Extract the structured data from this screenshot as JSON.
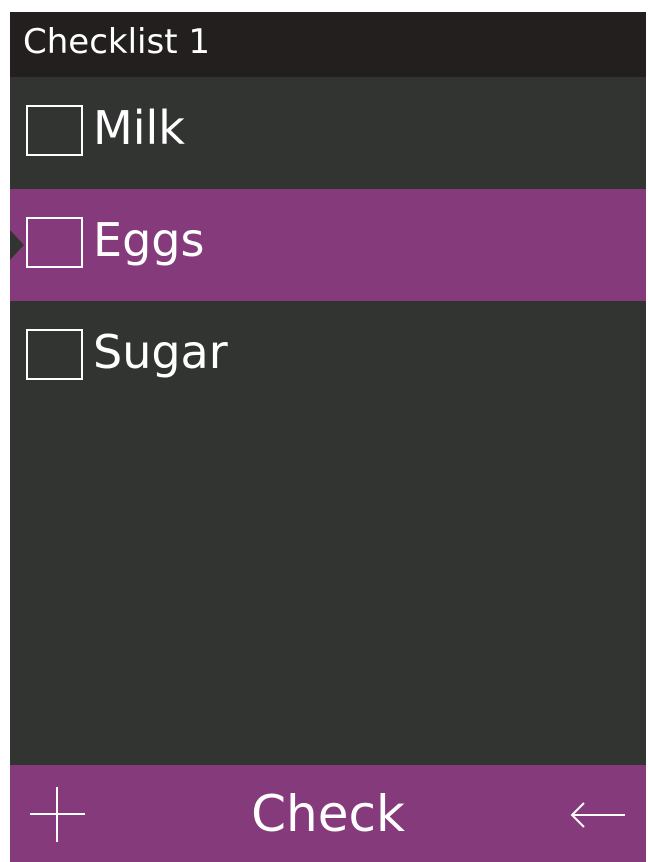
{
  "header": {
    "title": "Checklist 1"
  },
  "items": [
    {
      "label": "Milk",
      "checked": false,
      "selected": false
    },
    {
      "label": "Eggs",
      "checked": false,
      "selected": true
    },
    {
      "label": "Sugar",
      "checked": false,
      "selected": false
    }
  ],
  "softkeys": {
    "left_icon": "plus-icon",
    "center_label": "Check",
    "right_icon": "back-arrow-icon"
  },
  "colors": {
    "title_bar": "#231f1f",
    "background": "#323432",
    "accent": "#853a7c",
    "text": "#ffffff"
  }
}
